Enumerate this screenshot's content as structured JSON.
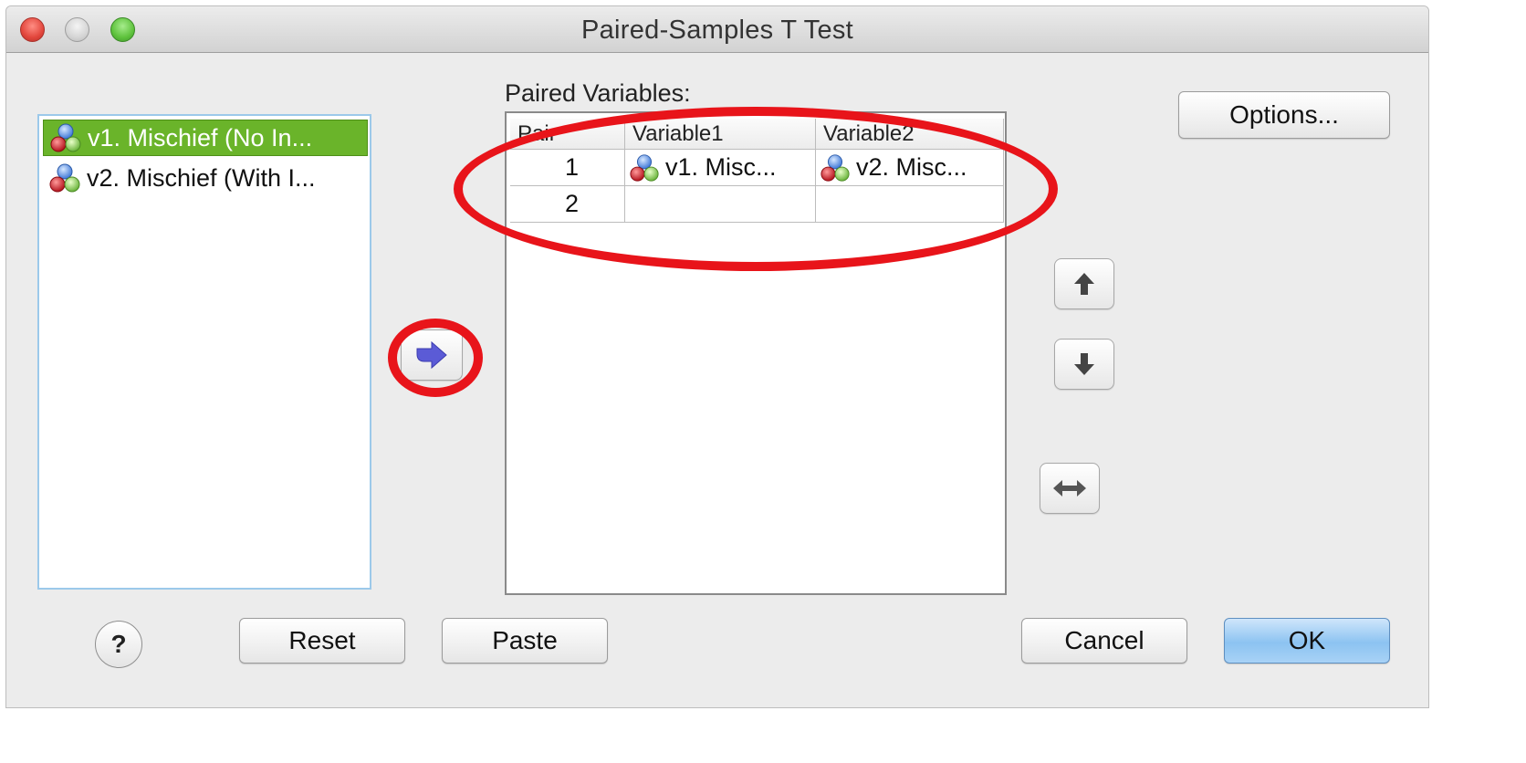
{
  "window": {
    "title": "Paired-Samples T Test"
  },
  "source_list": {
    "items": [
      {
        "label": "v1. Mischief (No In...",
        "selected": true,
        "icon": "scale-variable-icon"
      },
      {
        "label": "v2. Mischief (With I...",
        "selected": false,
        "icon": "scale-variable-icon"
      }
    ]
  },
  "paired_variables": {
    "label": "Paired Variables:",
    "columns": [
      "Pair",
      "Variable1",
      "Variable2"
    ],
    "rows": [
      {
        "pair": "1",
        "variable1": "v1. Misc...",
        "variable2": "v2. Misc..."
      },
      {
        "pair": "2",
        "variable1": "",
        "variable2": ""
      }
    ]
  },
  "buttons": {
    "options": "Options...",
    "reset": "Reset",
    "paste": "Paste",
    "cancel": "Cancel",
    "ok": "OK",
    "help": "?"
  },
  "colors": {
    "selection": "#6ab42a",
    "annotation": "#e8141a",
    "default_button": "#8cc3f1",
    "arrow_icon": "#5b5bd6"
  }
}
